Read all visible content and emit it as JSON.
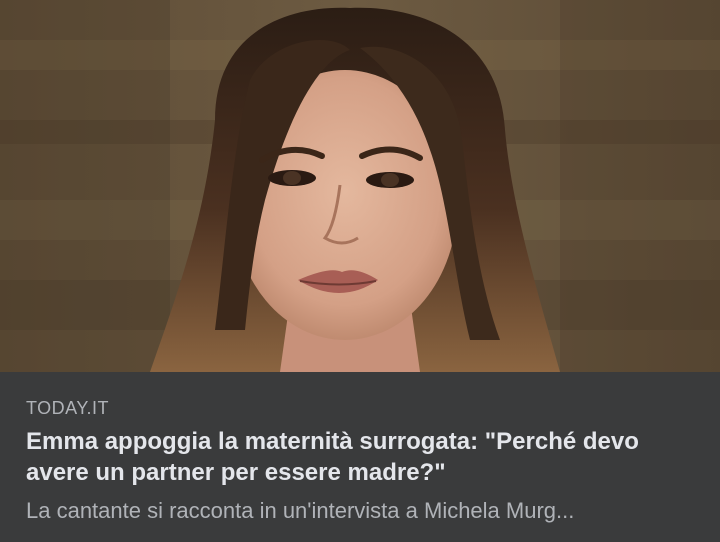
{
  "link_preview": {
    "image_alt": "",
    "source": "TODAY.IT",
    "headline": "Emma appoggia la maternità surrogata: \"Perché devo avere un partner per essere madre?\"",
    "description": "La cantante si racconta in un'intervista a Michela Murg..."
  },
  "colors": {
    "caption_bg": "#3a3b3c",
    "headline": "#e4e6eb",
    "secondary_text": "#b0b3b8"
  }
}
